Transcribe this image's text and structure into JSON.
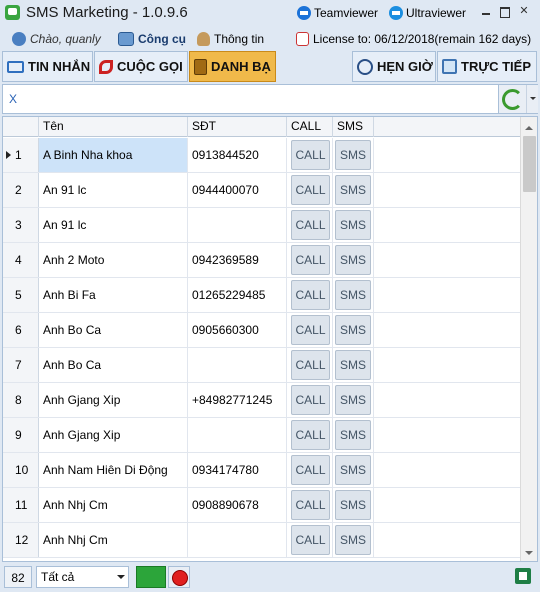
{
  "window": {
    "title": "SMS Marketing - 1.0.9.6",
    "teamviewer": "Teamviewer",
    "ultraviewer": "Ultraviewer"
  },
  "menu": {
    "hello": "Chào, quanly",
    "tools": "Công cụ",
    "info": "Thông tin",
    "license": "License to: 06/12/2018(remain 162 days)"
  },
  "tabs": [
    {
      "label": "TIN NHẮN"
    },
    {
      "label": "CUỘC GỌI"
    },
    {
      "label": "DANH BẠ"
    },
    {
      "label": "HẸN GIỜ"
    },
    {
      "label": "TRỰC TIẾP"
    }
  ],
  "search": {
    "value": "X"
  },
  "columns": {
    "name": "Tên",
    "phone": "SĐT",
    "call": "CALL",
    "sms": "SMS"
  },
  "buttons": {
    "call": "CALL",
    "sms": "SMS"
  },
  "rows": [
    {
      "idx": "1",
      "name": "A Binh Nha khoa",
      "phone": "0913844520"
    },
    {
      "idx": "2",
      "name": "An 91 lc",
      "phone": "0944400070"
    },
    {
      "idx": "3",
      "name": "An 91 lc",
      "phone": ""
    },
    {
      "idx": "4",
      "name": "Anh 2 Moto",
      "phone": "0942369589"
    },
    {
      "idx": "5",
      "name": "Anh Bi Fa",
      "phone": "01265229485"
    },
    {
      "idx": "6",
      "name": "Anh Bo Ca",
      "phone": "0905660300"
    },
    {
      "idx": "7",
      "name": "Anh Bo Ca",
      "phone": ""
    },
    {
      "idx": "8",
      "name": "Anh Gjang Xip",
      "phone": "+84982771245"
    },
    {
      "idx": "9",
      "name": "Anh Gjang Xip",
      "phone": ""
    },
    {
      "idx": "10",
      "name": "Anh Nam Hiên Di Động",
      "phone": "0934174780"
    },
    {
      "idx": "11",
      "name": "Anh Nhj Cm",
      "phone": "0908890678"
    },
    {
      "idx": "12",
      "name": "Anh Nhj Cm",
      "phone": ""
    }
  ],
  "status": {
    "count": "82",
    "filter": "Tất cả"
  }
}
